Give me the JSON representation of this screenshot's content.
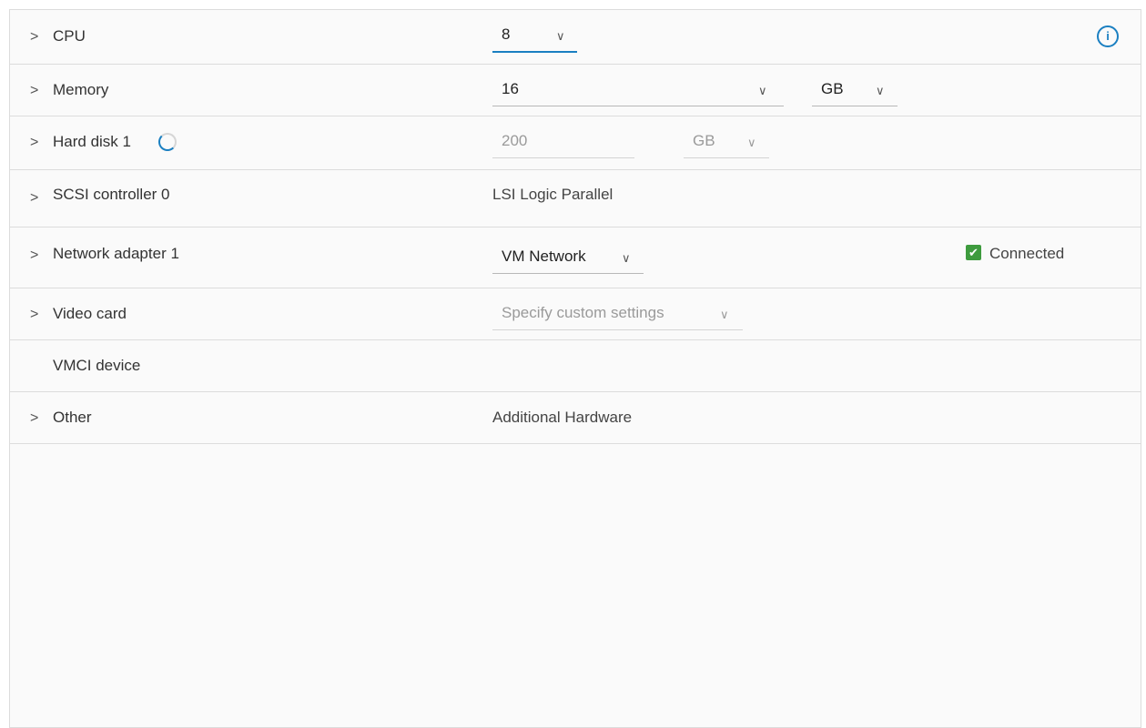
{
  "rows": {
    "cpu": {
      "label": "CPU",
      "value": "8",
      "info_icon": "info-circle-icon"
    },
    "memory": {
      "label": "Memory",
      "value": "16",
      "unit": "GB"
    },
    "hard_disk": {
      "label": "Hard disk 1",
      "value": "200",
      "unit": "GB",
      "status_icon": "loading-spinner-icon"
    },
    "scsi": {
      "label": "SCSI controller 0",
      "value": "LSI Logic Parallel"
    },
    "network": {
      "label": "Network adapter 1",
      "value": "VM Network",
      "connected_label": "Connected",
      "connected": true
    },
    "video": {
      "label": "Video card",
      "value": "Specify custom settings"
    },
    "vmci": {
      "label": "VMCI device"
    },
    "other": {
      "label": "Other",
      "value": "Additional Hardware"
    }
  },
  "glyphs": {
    "expand": ">",
    "dropdown": "∨",
    "info": "i",
    "check": "✔"
  },
  "colors": {
    "accent": "#1a7fc1",
    "checkbox": "#3e9b3e"
  }
}
